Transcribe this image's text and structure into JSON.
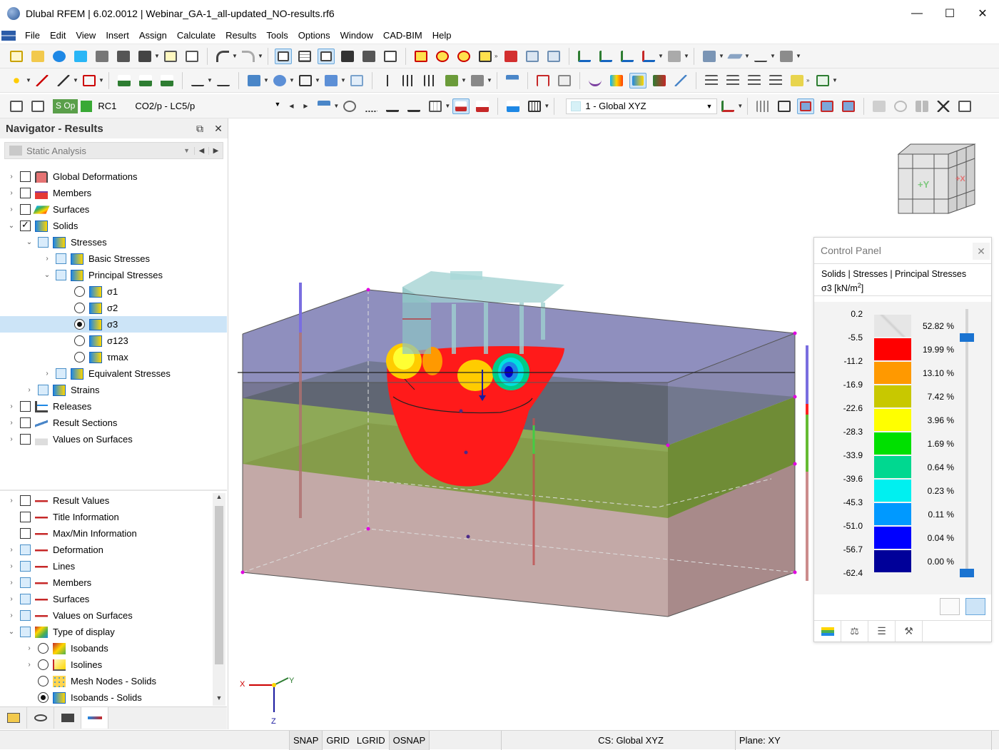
{
  "window": {
    "title": "Dlubal RFEM | 6.02.0012 | Webinar_GA-1_all-updated_NO-results.rf6",
    "minimize": "—",
    "maximize": "☐",
    "close": "✕"
  },
  "menu": [
    "File",
    "Edit",
    "View",
    "Insert",
    "Assign",
    "Calculate",
    "Results",
    "Tools",
    "Options",
    "Window",
    "CAD-BIM",
    "Help"
  ],
  "toolbar3": {
    "load_tag": "S Op",
    "result_combo": "RC1",
    "load_case": "CO2/p - LC5/p",
    "coordinate_system": "1 - Global XYZ"
  },
  "navigator": {
    "title": "Navigator - Results",
    "analysis_combo": "Static Analysis",
    "tree": [
      {
        "label": "Global Deformations"
      },
      {
        "label": "Members"
      },
      {
        "label": "Surfaces"
      },
      {
        "label": "Solids"
      },
      {
        "label": "Stresses"
      },
      {
        "label": "Basic Stresses"
      },
      {
        "label": "Principal Stresses"
      },
      {
        "label": "σ1"
      },
      {
        "label": "σ2"
      },
      {
        "label": "σ3"
      },
      {
        "label": "σ123"
      },
      {
        "label": "τmax"
      },
      {
        "label": "Equivalent Stresses"
      },
      {
        "label": "Strains"
      },
      {
        "label": "Releases"
      },
      {
        "label": "Result Sections"
      },
      {
        "label": "Values on Surfaces"
      }
    ],
    "display_tree": [
      {
        "label": "Result Values"
      },
      {
        "label": "Title Information"
      },
      {
        "label": "Max/Min Information"
      },
      {
        "label": "Deformation"
      },
      {
        "label": "Lines"
      },
      {
        "label": "Members"
      },
      {
        "label": "Surfaces"
      },
      {
        "label": "Values on Surfaces"
      },
      {
        "label": "Type of display"
      },
      {
        "label": "Isobands"
      },
      {
        "label": "Isolines"
      },
      {
        "label": "Mesh Nodes - Solids"
      },
      {
        "label": "Isobands - Solids"
      }
    ]
  },
  "control_panel": {
    "title": "Control Panel",
    "subtitle": "Solids | Stresses | Principal Stresses",
    "quantity": "σ3 [kN/m",
    "quantity_sup": "2",
    "quantity_end": "]",
    "legend_values": [
      "0.2",
      "-5.5",
      "-11.2",
      "-16.9",
      "-22.6",
      "-28.3",
      "-33.9",
      "-39.6",
      "-45.3",
      "-51.0",
      "-56.7",
      "-62.4"
    ],
    "legend_percent": [
      "52.82 %",
      "19.99 %",
      "13.10 %",
      "7.42 %",
      "3.96 %",
      "1.69 %",
      "0.64 %",
      "0.23 %",
      "0.11 %",
      "0.04 %",
      "0.00 %"
    ],
    "legend_colors": [
      "#e2e2e2",
      "#ff0000",
      "#ff9900",
      "#c8c800",
      "#ffff00",
      "#00e000",
      "#00d890",
      "#00f0f0",
      "#0099ff",
      "#0000ff",
      "#000099"
    ]
  },
  "axes": {
    "x": "X",
    "y": "Y",
    "z": "Z"
  },
  "view_cube": {
    "y_label": "+Y",
    "x_label": "+X"
  },
  "statusbar": {
    "snap": "SNAP",
    "grid": "GRID",
    "lgrid": "LGRID",
    "osnap": "OSNAP",
    "cs": "CS: Global XYZ",
    "plane": "Plane: XY"
  }
}
